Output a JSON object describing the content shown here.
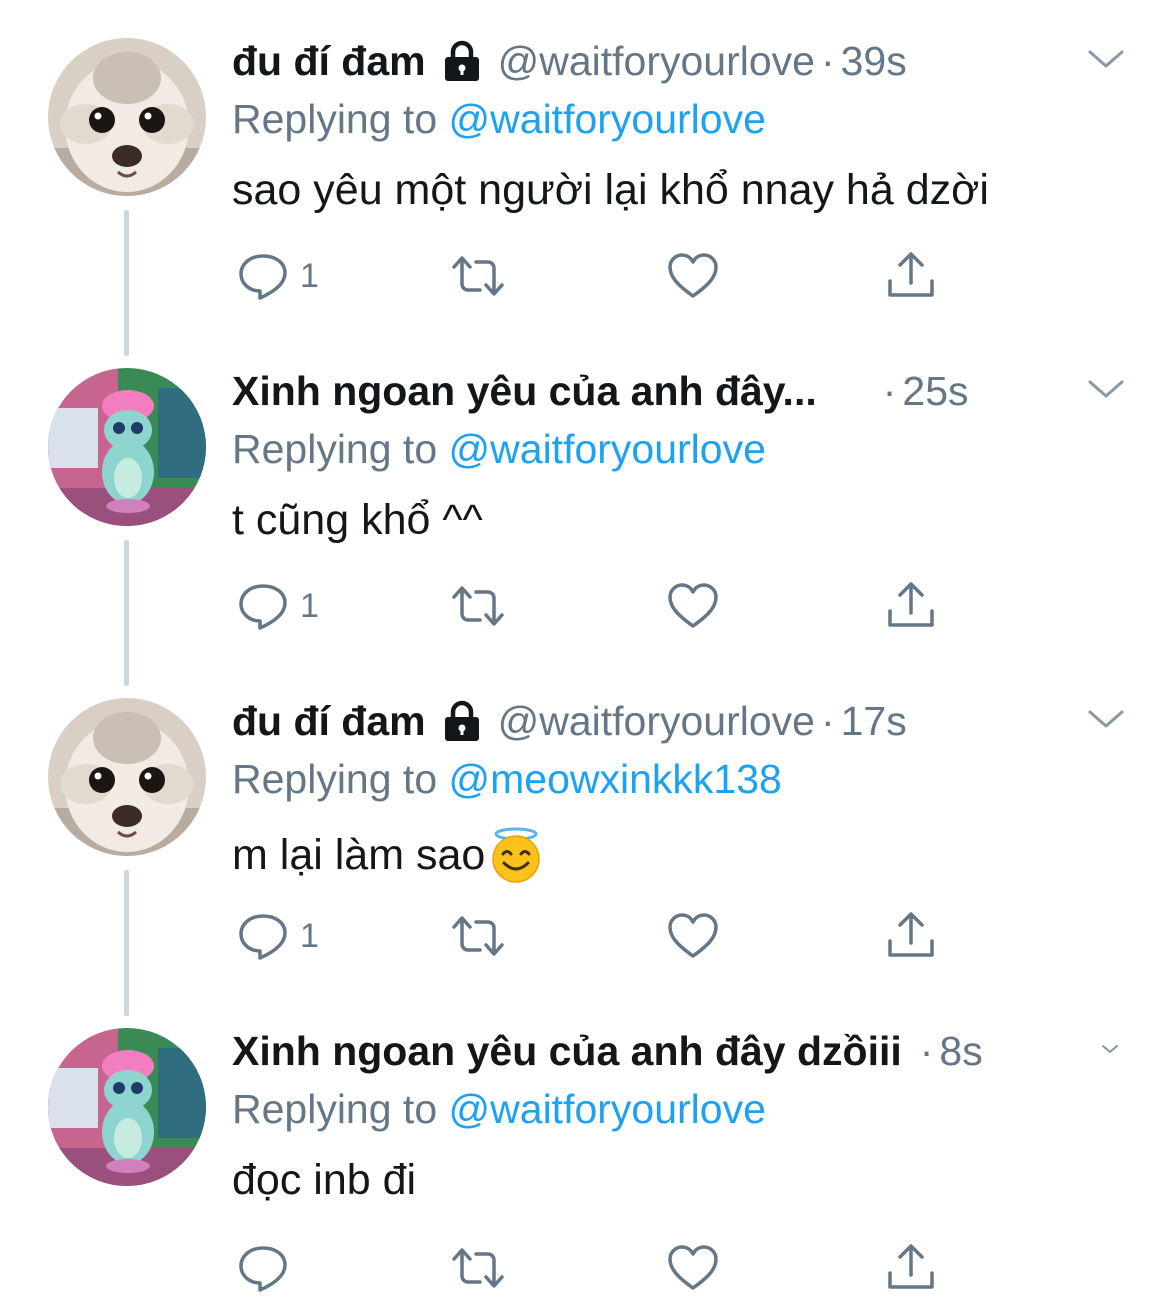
{
  "colors": {
    "text": "#14171a",
    "secondary": "#657786",
    "link": "#1da1f2",
    "thread_line": "#ccd6dd"
  },
  "tweets": [
    {
      "display_name": "đu đí đam",
      "locked": true,
      "handle": "@waitforyourlove",
      "separator": "·",
      "time": "39s",
      "replying_label": "Replying to",
      "replying_to": "@waitforyourlove",
      "text": "sao yêu một người lại khổ nnay hả dzời",
      "reply_count": "1",
      "avatar": "dog-avatar"
    },
    {
      "display_name": "Xinh ngoan yêu của anh đây...",
      "locked": false,
      "handle": "",
      "separator": "·",
      "time": "25s",
      "replying_label": "Replying to",
      "replying_to": "@waitforyourlove",
      "text": "t cũng khổ ^^",
      "reply_count": "1",
      "avatar": "cartoon-avatar"
    },
    {
      "display_name": "đu đí đam",
      "locked": true,
      "handle": "@waitforyourlove",
      "separator": "·",
      "time": "17s",
      "replying_label": "Replying to",
      "replying_to": "@meowxinkkk138",
      "text": "m lại làm sao",
      "emoji": "smiling-face-with-halo",
      "reply_count": "1",
      "avatar": "dog-avatar"
    },
    {
      "display_name": "Xinh ngoan yêu của anh đây dzồiii",
      "locked": false,
      "handle": "",
      "separator": "·",
      "time": "8s",
      "replying_label": "Replying to",
      "replying_to": "@waitforyourlove",
      "text": "đọc inb đi",
      "reply_count": "",
      "avatar": "cartoon-avatar"
    }
  ]
}
